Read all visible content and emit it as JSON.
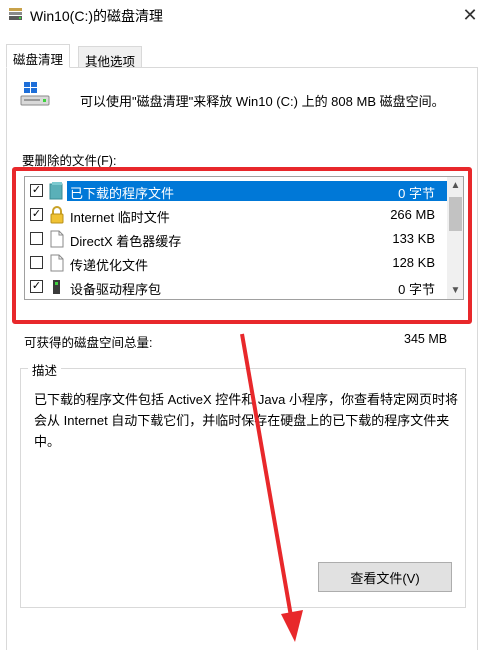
{
  "window": {
    "title": "Win10(C:)的磁盘清理",
    "close_glyph": "✕"
  },
  "tabs": [
    {
      "label": "磁盘清理",
      "active": true
    },
    {
      "label": "其他选项",
      "active": false
    }
  ],
  "intro": {
    "text": "可以使用\"磁盘清理\"来释放 Win10 (C:) 上的 808 MB 磁盘空间。"
  },
  "files_label": "要删除的文件(F):",
  "files": [
    {
      "checked": true,
      "icon": "folder-icon",
      "name": "已下载的程序文件",
      "size": "0 字节",
      "selected": true
    },
    {
      "checked": true,
      "icon": "lock-icon",
      "name": "Internet 临时文件",
      "size": "266 MB",
      "selected": false
    },
    {
      "checked": false,
      "icon": "document-icon",
      "name": "DirectX 着色器缓存",
      "size": "133 KB",
      "selected": false
    },
    {
      "checked": false,
      "icon": "document-icon",
      "name": "传递优化文件",
      "size": "128 KB",
      "selected": false
    },
    {
      "checked": true,
      "icon": "device-icon",
      "name": "设备驱动程序包",
      "size": "0 字节",
      "selected": false
    }
  ],
  "check_glyph": "✓",
  "scroll": {
    "up_glyph": "▲",
    "down_glyph": "▼"
  },
  "total": {
    "label": "可获得的磁盘空间总量:",
    "value": "345 MB"
  },
  "description": {
    "legend": "描述",
    "text": "已下载的程序文件包括 ActiveX 控件和 Java 小程序，你查看特定网页时将会从 Internet 自动下载它们，并临时保存在硬盘上的已下载的程序文件夹中。"
  },
  "view_files_button": "查看文件(V)",
  "colors": {
    "selection": "#0078d7",
    "annotation": "#e8282b"
  }
}
